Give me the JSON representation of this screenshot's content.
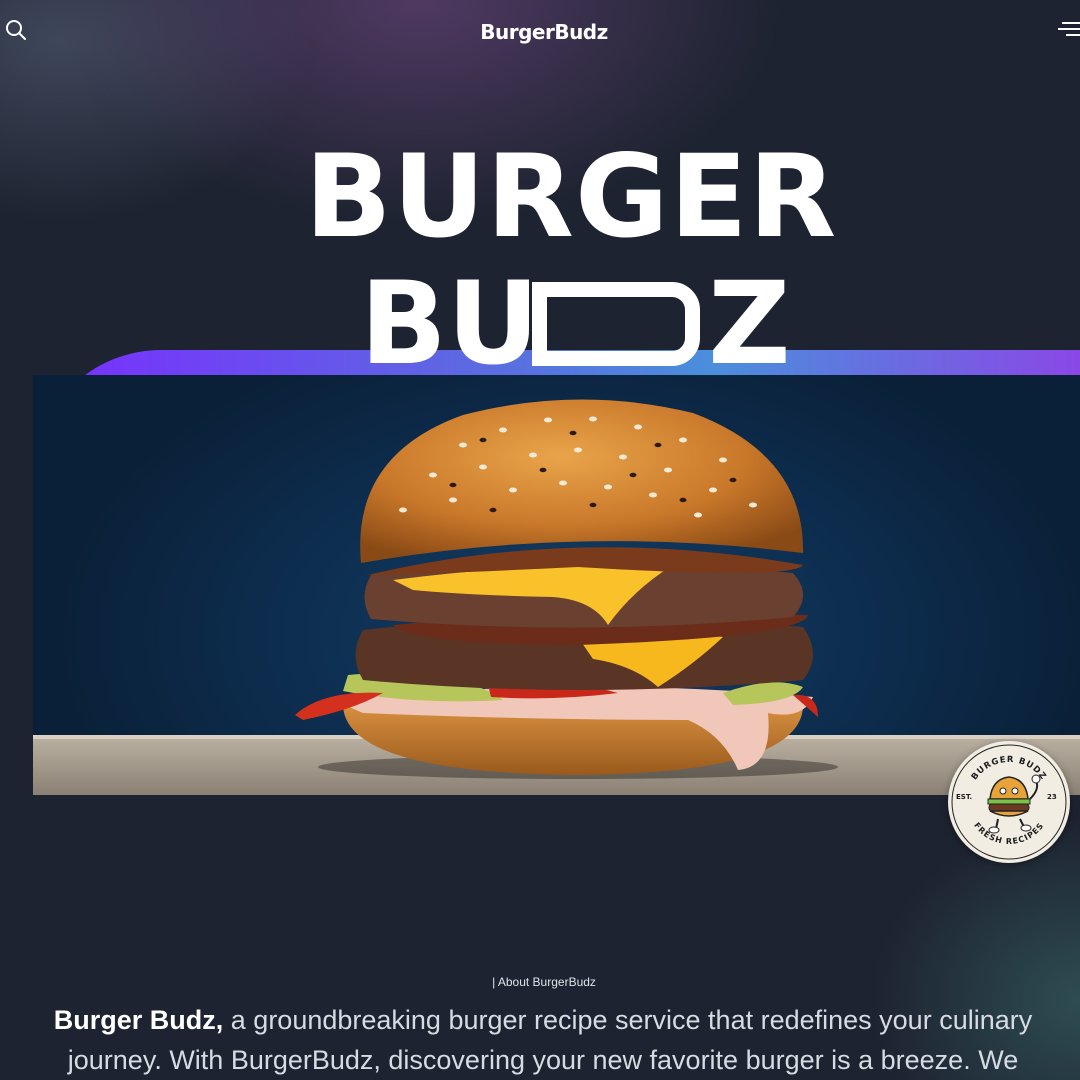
{
  "header": {
    "brand": "BurgerBudz",
    "search_icon": "search-icon",
    "menu_icon": "hamburger-menu-icon"
  },
  "hero": {
    "title_line1": "BURGER",
    "title_line2_prefix": "BU",
    "title_line2_suffix": "Z",
    "title_line2_shape": "D"
  },
  "badge": {
    "top_text": "BURGER BUDZ",
    "left_text": "EST.",
    "right_text": "23",
    "bottom_text": "FRESH RECIPES"
  },
  "about": {
    "label": "| About BurgerBudz",
    "lead": "Burger Budz,",
    "body": " a groundbreaking burger recipe service that redefines your culinary journey. With BurgerBudz, discovering your new favorite burger is a breeze. We"
  },
  "colors": {
    "background": "#1d2330",
    "arc_start": "#7a2cff",
    "arc_mid": "#4a8fdc",
    "arc_end": "#8a48e6",
    "image_bg": "#0d2c4d"
  }
}
